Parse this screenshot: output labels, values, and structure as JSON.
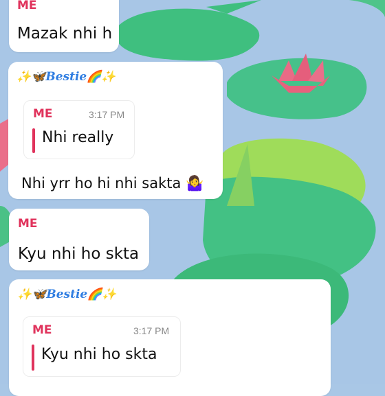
{
  "messages": [
    {
      "sender": "ME",
      "text": "Mazak nhi h"
    },
    {
      "sender": "✨🦋Bestie🌈✨",
      "reply_to": {
        "sender": "ME",
        "time": "3:17 PM",
        "text": "Nhi really"
      },
      "text": "Nhi yrr ho hi nhi sakta 🤷‍♀️"
    },
    {
      "sender": "ME",
      "text": "Kyu nhi ho skta"
    },
    {
      "sender": "✨🦋Bestie🌈✨",
      "reply_to": {
        "sender": "ME",
        "time": "3:17 PM",
        "text": "Kyu nhi ho skta"
      }
    }
  ],
  "colors": {
    "me": "#e0335c",
    "bestie": "#2f7de1",
    "bubble": "#ffffff"
  }
}
